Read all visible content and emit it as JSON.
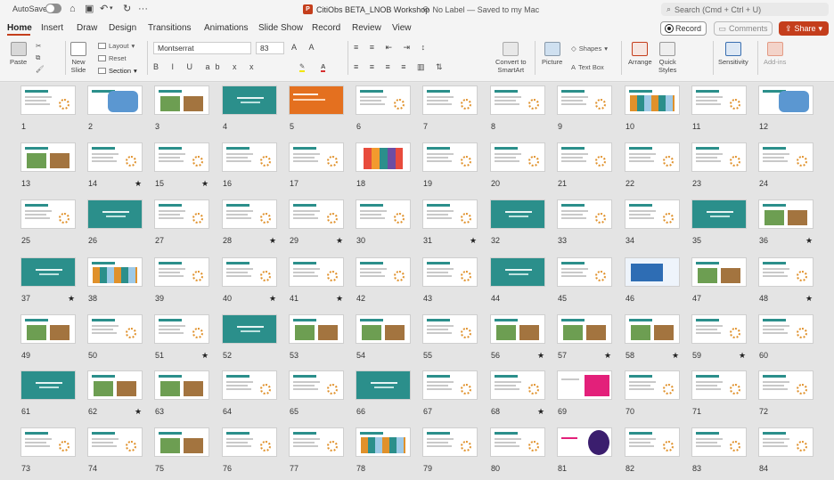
{
  "titlebar": {
    "autosave_label": "AutoSave",
    "doc_title": "CitiObs BETA_LNOB Workshop",
    "status": "No Label — Saved to my Mac",
    "search_placeholder": "Search (Cmd + Ctrl + U)"
  },
  "tabs": [
    "Home",
    "Insert",
    "Draw",
    "Design",
    "Transitions",
    "Animations",
    "Slide Show",
    "Record",
    "Review",
    "View"
  ],
  "actions": {
    "record": "Record",
    "comments": "Comments",
    "share": "Share"
  },
  "ribbon": {
    "paste": "Paste",
    "new_slide": "New\nSlide",
    "layout": "Layout",
    "reset": "Reset",
    "section": "Section",
    "font_name": "Montserrat",
    "font_size": "83",
    "convert_smartart": "Convert to\nSmartArt",
    "picture": "Picture",
    "shapes": "Shapes",
    "text_box": "Text Box",
    "arrange": "Arrange",
    "quick_styles": "Quick\nStyles",
    "sensitivity": "Sensitivity",
    "add_ins": "Add-ins"
  },
  "colors": {
    "accent": "#c43e1c",
    "teal": "#2b8f8b",
    "orange": "#e0912b"
  },
  "slides": [
    {
      "n": "1",
      "star": false,
      "t": "w"
    },
    {
      "n": "2",
      "star": false,
      "t": "map"
    },
    {
      "n": "3",
      "star": false,
      "t": "photo"
    },
    {
      "n": "4",
      "star": false,
      "t": "teal"
    },
    {
      "n": "5",
      "star": false,
      "t": "orange"
    },
    {
      "n": "6",
      "star": false,
      "t": "w"
    },
    {
      "n": "7",
      "star": false,
      "t": "w"
    },
    {
      "n": "8",
      "star": false,
      "t": "w"
    },
    {
      "n": "9",
      "star": false,
      "t": "w"
    },
    {
      "n": "10",
      "star": false,
      "t": "grid"
    },
    {
      "n": "11",
      "star": false,
      "t": "w"
    },
    {
      "n": "12",
      "star": false,
      "t": "map"
    },
    {
      "n": "13",
      "star": false,
      "t": "photo"
    },
    {
      "n": "14",
      "star": true,
      "t": "w"
    },
    {
      "n": "15",
      "star": true,
      "t": "w"
    },
    {
      "n": "16",
      "star": false,
      "t": "w"
    },
    {
      "n": "17",
      "star": false,
      "t": "w"
    },
    {
      "n": "18",
      "star": false,
      "t": "bars"
    },
    {
      "n": "19",
      "star": false,
      "t": "w"
    },
    {
      "n": "20",
      "star": false,
      "t": "w"
    },
    {
      "n": "21",
      "star": false,
      "t": "w"
    },
    {
      "n": "22",
      "star": false,
      "t": "w"
    },
    {
      "n": "23",
      "star": false,
      "t": "w"
    },
    {
      "n": "24",
      "star": false,
      "t": "w"
    },
    {
      "n": "25",
      "star": false,
      "t": "w"
    },
    {
      "n": "26",
      "star": false,
      "t": "teal"
    },
    {
      "n": "27",
      "star": false,
      "t": "w"
    },
    {
      "n": "28",
      "star": true,
      "t": "w"
    },
    {
      "n": "29",
      "star": true,
      "t": "w"
    },
    {
      "n": "30",
      "star": false,
      "t": "w"
    },
    {
      "n": "31",
      "star": true,
      "t": "w"
    },
    {
      "n": "32",
      "star": false,
      "t": "teal"
    },
    {
      "n": "33",
      "star": false,
      "t": "w"
    },
    {
      "n": "34",
      "star": false,
      "t": "w"
    },
    {
      "n": "35",
      "star": false,
      "t": "teal"
    },
    {
      "n": "36",
      "star": true,
      "t": "photo"
    },
    {
      "n": "37",
      "star": true,
      "t": "teal"
    },
    {
      "n": "38",
      "star": false,
      "t": "grid"
    },
    {
      "n": "39",
      "star": false,
      "t": "w"
    },
    {
      "n": "40",
      "star": true,
      "t": "w"
    },
    {
      "n": "41",
      "star": true,
      "t": "w"
    },
    {
      "n": "42",
      "star": false,
      "t": "w"
    },
    {
      "n": "43",
      "star": false,
      "t": "w"
    },
    {
      "n": "44",
      "star": false,
      "t": "teal"
    },
    {
      "n": "45",
      "star": false,
      "t": "w"
    },
    {
      "n": "46",
      "star": false,
      "t": "blue"
    },
    {
      "n": "47",
      "star": false,
      "t": "photo"
    },
    {
      "n": "48",
      "star": true,
      "t": "w"
    },
    {
      "n": "49",
      "star": false,
      "t": "photo"
    },
    {
      "n": "50",
      "star": false,
      "t": "w"
    },
    {
      "n": "51",
      "star": true,
      "t": "w"
    },
    {
      "n": "52",
      "star": false,
      "t": "teal"
    },
    {
      "n": "53",
      "star": false,
      "t": "photo"
    },
    {
      "n": "54",
      "star": false,
      "t": "photo"
    },
    {
      "n": "55",
      "star": false,
      "t": "w"
    },
    {
      "n": "56",
      "star": true,
      "t": "photo"
    },
    {
      "n": "57",
      "star": true,
      "t": "photo"
    },
    {
      "n": "58",
      "star": true,
      "t": "photo"
    },
    {
      "n": "59",
      "star": true,
      "t": "w"
    },
    {
      "n": "60",
      "star": false,
      "t": "w"
    },
    {
      "n": "61",
      "star": false,
      "t": "teal"
    },
    {
      "n": "62",
      "star": true,
      "t": "photo"
    },
    {
      "n": "63",
      "star": false,
      "t": "photo"
    },
    {
      "n": "64",
      "star": false,
      "t": "w"
    },
    {
      "n": "65",
      "star": false,
      "t": "w"
    },
    {
      "n": "66",
      "star": false,
      "t": "teal"
    },
    {
      "n": "67",
      "star": false,
      "t": "w"
    },
    {
      "n": "68",
      "star": true,
      "t": "w"
    },
    {
      "n": "69",
      "star": false,
      "t": "pink"
    },
    {
      "n": "70",
      "star": false,
      "t": "w"
    },
    {
      "n": "71",
      "star": false,
      "t": "w"
    },
    {
      "n": "72",
      "star": false,
      "t": "w"
    },
    {
      "n": "73",
      "star": false,
      "t": "w"
    },
    {
      "n": "74",
      "star": false,
      "t": "w"
    },
    {
      "n": "75",
      "star": false,
      "t": "photo"
    },
    {
      "n": "76",
      "star": false,
      "t": "w"
    },
    {
      "n": "77",
      "star": false,
      "t": "w"
    },
    {
      "n": "78",
      "star": false,
      "t": "grid"
    },
    {
      "n": "79",
      "star": false,
      "t": "w"
    },
    {
      "n": "80",
      "star": false,
      "t": "w"
    },
    {
      "n": "81",
      "star": false,
      "t": "purple"
    },
    {
      "n": "82",
      "star": false,
      "t": "w"
    },
    {
      "n": "83",
      "star": false,
      "t": "w"
    },
    {
      "n": "84",
      "star": false,
      "t": "w"
    }
  ]
}
